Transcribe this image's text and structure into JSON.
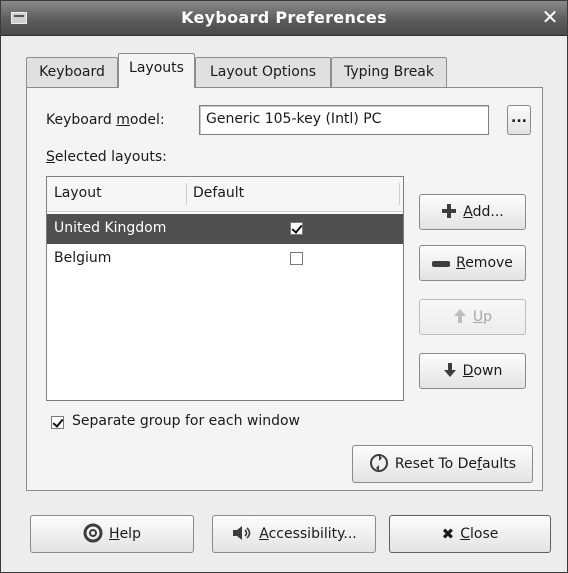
{
  "window": {
    "title": "Keyboard Preferences"
  },
  "tabs": [
    {
      "label": "Keyboard"
    },
    {
      "label": "Layouts"
    },
    {
      "label": "Layout Options"
    },
    {
      "label": "Typing Break"
    }
  ],
  "active_tab": "Layouts",
  "model": {
    "label_pre": "Keyboard ",
    "label_u": "m",
    "label_post": "odel:",
    "value": "Generic 105-key (Intl) PC",
    "more_label": "..."
  },
  "selected_layouts": {
    "label_u": "S",
    "label_post": "elected layouts:",
    "columns": [
      "Layout",
      "Default"
    ],
    "rows": [
      {
        "name": "United Kingdom",
        "default": true,
        "selected": true
      },
      {
        "name": "Belgium",
        "default": false,
        "selected": false
      }
    ]
  },
  "side_buttons": {
    "add": {
      "u": "A",
      "rest": "dd...",
      "icon": "plus-icon"
    },
    "remove": {
      "u": "R",
      "rest": "emove",
      "icon": "minus-icon"
    },
    "up": {
      "u": "U",
      "rest": "p",
      "icon": "up-arrow-icon",
      "disabled": true
    },
    "down": {
      "u": "D",
      "rest": "own",
      "icon": "down-arrow-icon"
    }
  },
  "separate_group": {
    "checked": true,
    "pre": "Separate ",
    "u": "g",
    "post": "roup for each window"
  },
  "reset": {
    "pre": "Reset To De",
    "u": "f",
    "post": "aults",
    "icon": "reset-icon"
  },
  "footer": {
    "help": {
      "u": "H",
      "rest": "elp",
      "icon": "help-icon"
    },
    "accessibility": {
      "u": "A",
      "rest": "ccessibility...",
      "icon": "accessibility-icon"
    },
    "close": {
      "u": "C",
      "rest": "lose",
      "icon": "close-icon"
    }
  }
}
